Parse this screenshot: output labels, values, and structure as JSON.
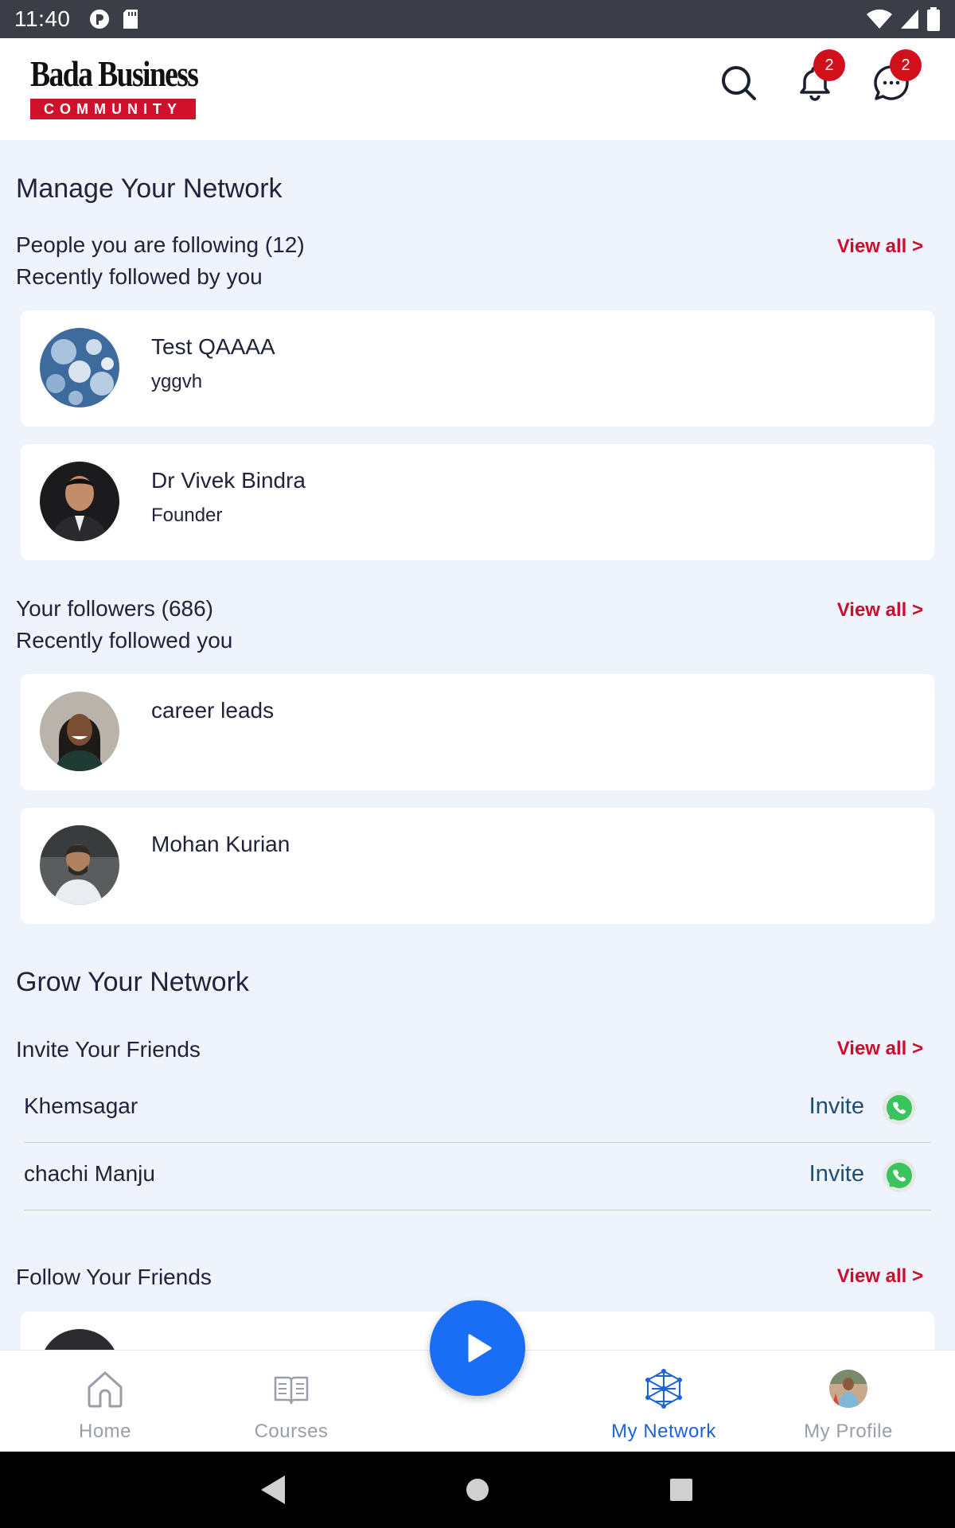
{
  "status_bar": {
    "time": "11:40"
  },
  "header": {
    "logo_top": "Bada Business",
    "logo_bottom": "COMMUNITY",
    "notifications_badge": "2",
    "messages_badge": "2"
  },
  "manage": {
    "title": "Manage Your Network",
    "following": {
      "title": "People you are following (12)",
      "caption": "Recently followed by you",
      "view_all": "View all >",
      "people": [
        {
          "name": "Test QAAAA",
          "role": "yggvh"
        },
        {
          "name": "Dr Vivek Bindra",
          "role": "Founder"
        }
      ]
    },
    "followers": {
      "title": "Your followers (686)",
      "caption": "Recently followed you",
      "view_all": "View all >",
      "people": [
        {
          "name": "career leads",
          "role": ""
        },
        {
          "name": "Mohan Kurian",
          "role": ""
        }
      ]
    }
  },
  "grow": {
    "title": "Grow Your Network",
    "invite": {
      "title": "Invite Your Friends",
      "view_all": "View all >",
      "friends": [
        {
          "name": "Khemsagar",
          "action": "Invite"
        },
        {
          "name": "chachi Manju",
          "action": "Invite"
        }
      ]
    },
    "follow": {
      "title": "Follow Your Friends",
      "view_all": "View all >"
    }
  },
  "bottom_nav": {
    "items": [
      {
        "label": "Home",
        "icon": "home-icon"
      },
      {
        "label": "Courses",
        "icon": "courses-icon"
      },
      {
        "label": "My Network",
        "icon": "network-icon"
      },
      {
        "label": "My Profile",
        "icon": "profile-avatar"
      }
    ],
    "active": "My Network"
  },
  "colors": {
    "accent_red": "#c8102e",
    "active_blue": "#1e63d6",
    "fab_blue": "#1a6ef5",
    "page_bg": "#eff3fb"
  }
}
